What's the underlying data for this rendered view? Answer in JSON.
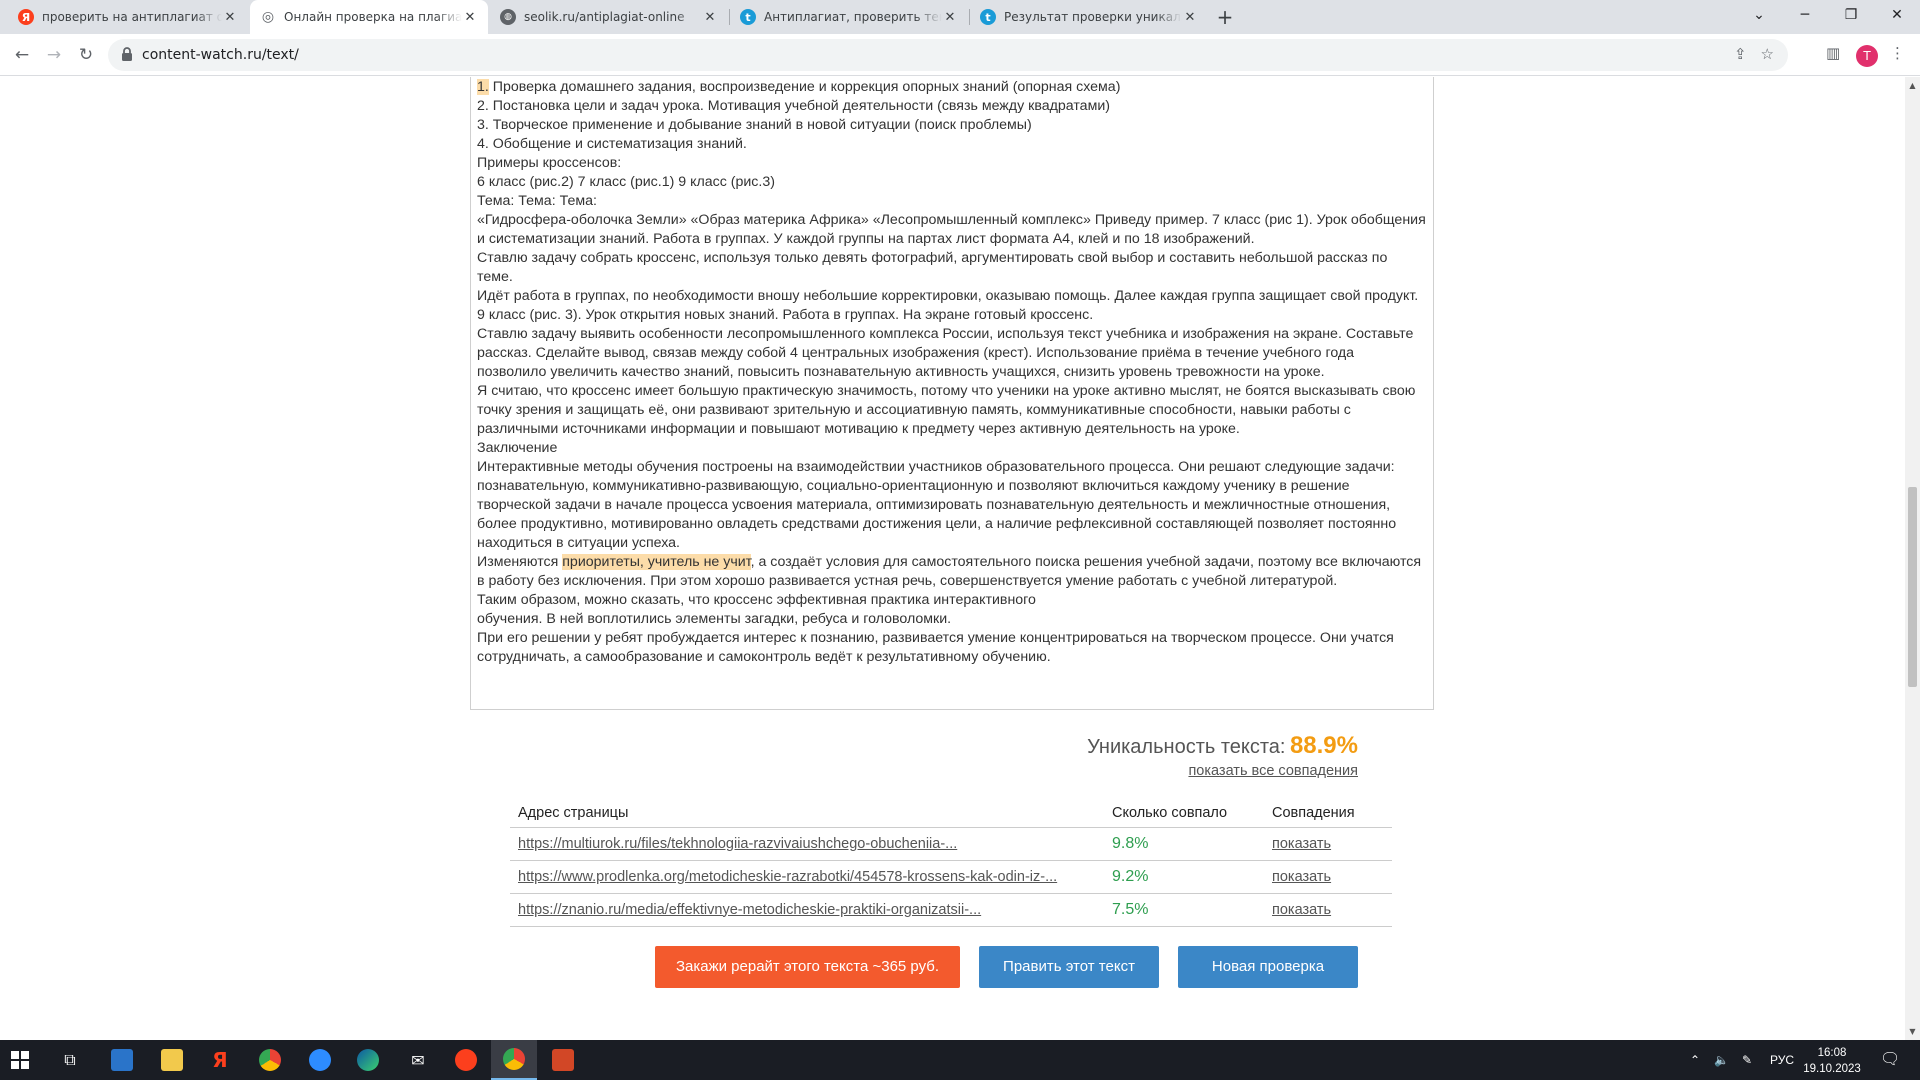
{
  "browser": {
    "tabs": [
      {
        "title": "проверить на антиплагиат онлайн",
        "favicon": "yandex-icon",
        "color": "#fc3f1d",
        "glyph": "Я",
        "active": false
      },
      {
        "title": "Онлайн проверка на плагиат -",
        "favicon": "content-watch-icon",
        "color": "#5f6368",
        "glyph": "◎",
        "active": true
      },
      {
        "title": "seolik.ru/antiplagiat-online",
        "favicon": "globe-icon",
        "color": "#5f6368",
        "glyph": "🌐",
        "active": false
      },
      {
        "title": "Антиплагиат, проверить текст",
        "favicon": "text-ru-icon",
        "color": "#1a9bd7",
        "glyph": "t",
        "active": false
      },
      {
        "title": "Результат проверки уникально",
        "favicon": "text-ru-icon",
        "color": "#1a9bd7",
        "glyph": "t",
        "active": false
      }
    ],
    "address": "content-watch.ru/text/",
    "profile_initial": "T"
  },
  "content": {
    "paragraphs": [
      {
        "pre_hl": "1.",
        "text": " Проверка домашнего задания, воспроизведение и коррекция опорных знаний (опорная схема)"
      },
      {
        "text": "2. Постановка цели и задач урока. Мотивация учебной деятельности (связь между квадратами)"
      },
      {
        "text": "3. Творческое применение и добывание знаний в новой ситуации (поиск проблемы)"
      },
      {
        "text": "4. Обобщение и систематизация знаний."
      },
      {
        "text": "Примеры кроссенсов:"
      },
      {
        "text": "6 класс (рис.2) 7 класс (рис.1) 9 класс (рис.3)"
      },
      {
        "text": "Тема: Тема: Тема:"
      },
      {
        "text": "«Гидросфера-оболочка Земли» «Образ материка Африка» «Лесопромышленный комплекс» Приведу пример. 7 класс (рис 1). Урок обобщения и систематизации знаний. Работа в группах. У каждой группы на партах лист формата А4, клей и по 18 изображений."
      },
      {
        "text": "Ставлю задачу собрать кроссенс, используя только девять фотографий, аргументировать свой выбор и составить небольшой рассказ по теме."
      },
      {
        "text": "Идёт работа в группах, по необходимости вношу небольшие корректировки, оказываю помощь. Далее каждая группа защищает свой продукт."
      },
      {
        "text": "9 класс (рис. 3). Урок открытия новых знаний. Работа в группах. На экране готовый кроссенс."
      },
      {
        "text": "Ставлю задачу выявить особенности лесопромышленного комплекса России, используя текст учебника и изображения на экране. Составьте рассказ. Сделайте вывод, связав между собой 4 центральных изображения (крест). Использование приёма в течение учебного года позволило увеличить качество знаний, повысить познавательную активность учащихся, снизить уровень тревожности на уроке."
      },
      {
        "text": "Я считаю, что кроссенс имеет большую практическую значимость, потому что ученики на уроке активно мыслят, не боятся высказывать свою точку зрения и защищать её, они развивают зрительную и ассоциативную память, коммуникативные способности, навыки работы с различными источниками информации и повышают мотивацию к предмету через активную деятельность на уроке."
      },
      {
        "text": "Заключение"
      },
      {
        "text": "Интерактивные методы обучения построены на взаимодействии участников образовательного процесса. Они решают следующие задачи: познавательную, коммуникативно-развивающую, социально-ориентационную и позволяют включиться каждому ученику в решение творческой задачи в начале процесса усвоения материала, оптимизировать познавательную деятельность и межличностные отношения, более продуктивно, мотивированно овладеть средствами достижения цели, а наличие рефлексивной составляющей позволяет постоянно находиться в ситуации успеха."
      },
      {
        "text_before": "Изменяются ",
        "highlight": "приоритеты, учитель не учит",
        "text": ", а создаёт условия для самостоятельного поиска решения учебной задачи, поэтому все включаются в работу без исключения. При этом хорошо развивается устная речь, совершенствуется умение работать с учебной литературой."
      },
      {
        "text": "Таким образом, можно сказать, что кроссенс эффективная практика интерактивного"
      },
      {
        "text": "обучения. В ней воплотились элементы загадки, ребуса и головоломки."
      },
      {
        "text": "При его решении у ребят пробуждается интерес к познанию, развивается умение концентрироваться на творческом процессе. Они учатся сотрудничать, а самообразование и самоконтроль ведёт к результативному обучению."
      }
    ]
  },
  "result": {
    "uniqueness_label": "Уникальность текста:",
    "uniqueness_value": "88.9%",
    "show_all": "показать все совпадения",
    "columns": [
      "Адрес страницы",
      "Сколько совпало",
      "Совпадения"
    ],
    "rows": [
      {
        "url": "https://multiurok.ru/files/tekhnologiia-razvivaiushchego-obucheniia-...",
        "pct": "9.8%",
        "action": "показать"
      },
      {
        "url": "https://www.prodlenka.org/metodicheskie-razrabotki/454578-krossens-kak-odin-iz-...",
        "pct": "9.2%",
        "action": "показать"
      },
      {
        "url": "https://znanio.ru/media/effektivnye-metodicheskie-praktiki-organizatsii-...",
        "pct": "7.5%",
        "action": "показать"
      }
    ]
  },
  "buttons": {
    "rewrite": "Закажи рерайт этого текста ~365 руб.",
    "edit": "Править этот текст",
    "new_check": "Новая проверка"
  },
  "taskbar": {
    "lang": "РУС",
    "time": "16:08",
    "date": "19.10.2023"
  },
  "colors": {
    "accent_orange": "#f35a2d",
    "accent_blue": "#3b87c7",
    "uniqueness": "#f39c12",
    "match_pct": "#2e9e4f",
    "highlight": "#fcdca9"
  }
}
